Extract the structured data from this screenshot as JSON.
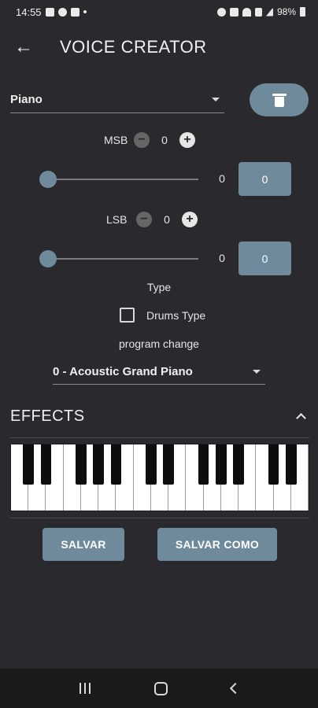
{
  "status_bar": {
    "time": "14:55",
    "battery": "98%",
    "icons": [
      "gallery-icon",
      "whatsapp-icon",
      "teams-icon",
      "dot-icon",
      "alarm-icon",
      "mute-icon",
      "wifi-icon",
      "volte-icon",
      "signal-icon",
      "battery-icon"
    ]
  },
  "appbar": {
    "back_icon": "arrow-left-icon",
    "title": "VOICE CREATOR"
  },
  "voice": {
    "selected": "Piano"
  },
  "delete_icon": "trash-icon",
  "msb": {
    "label": "MSB",
    "value": "0",
    "slider_value": "0",
    "box_value": "0",
    "level": 0
  },
  "lsb": {
    "label": "LSB",
    "value": "0",
    "slider_value": "0",
    "box_value": "0",
    "level": 0
  },
  "type_label": "Type",
  "drums": {
    "label": "Drums Type",
    "checked": false
  },
  "program_change_label": "program change",
  "program": {
    "selected": "0 - Acoustic Grand Piano"
  },
  "effects": {
    "title": "EFFECTS",
    "expanded": true
  },
  "keyboard": {
    "white_keys": 17
  },
  "buttons": {
    "save": "SALVAR",
    "save_as": "SALVAR COMO"
  },
  "accent_color": "#6e8a9b"
}
